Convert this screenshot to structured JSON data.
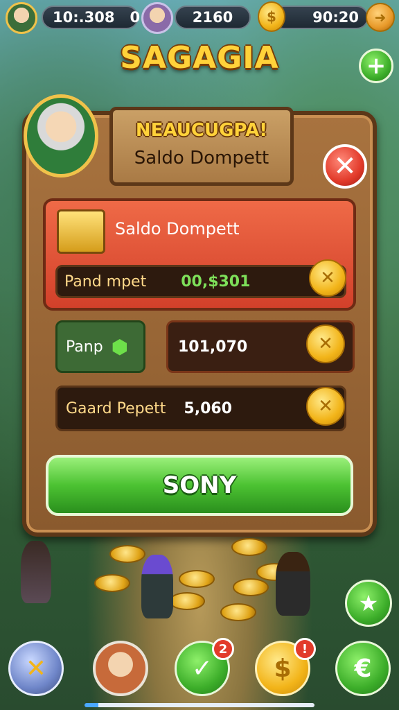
{
  "topbar": {
    "stat1": "10:.308",
    "stat2": "0",
    "stat3": "2160",
    "currency": "90:20"
  },
  "game_title": "SAGAGIA",
  "dialog": {
    "banner_title": "NEAUCUGPA!",
    "banner_subtitle": "Saldo Dompett",
    "card_title": "Saldo Dompett",
    "rows": [
      {
        "label": "Pand mpet",
        "value": "00,$301"
      },
      {
        "label": "Panp",
        "value": "101,070"
      },
      {
        "label": "Gaard Pepett",
        "value": "5,060"
      }
    ],
    "confirm_label": "SONY"
  },
  "bottom_nav": {
    "badge_1": "2",
    "badge_2": "!"
  },
  "colors": {
    "accent_green": "#4cc232",
    "panel_brown": "#8a5a2e",
    "card_red": "#d2402a",
    "gold": "#f2b419"
  },
  "icons": [
    "avatar",
    "gold-coin",
    "plus-icon",
    "close-icon",
    "gold-bars-icon",
    "gem-icon",
    "star-icon",
    "crossed-swords-icon",
    "checkmark-icon",
    "dollar-icon",
    "euro-icon"
  ]
}
